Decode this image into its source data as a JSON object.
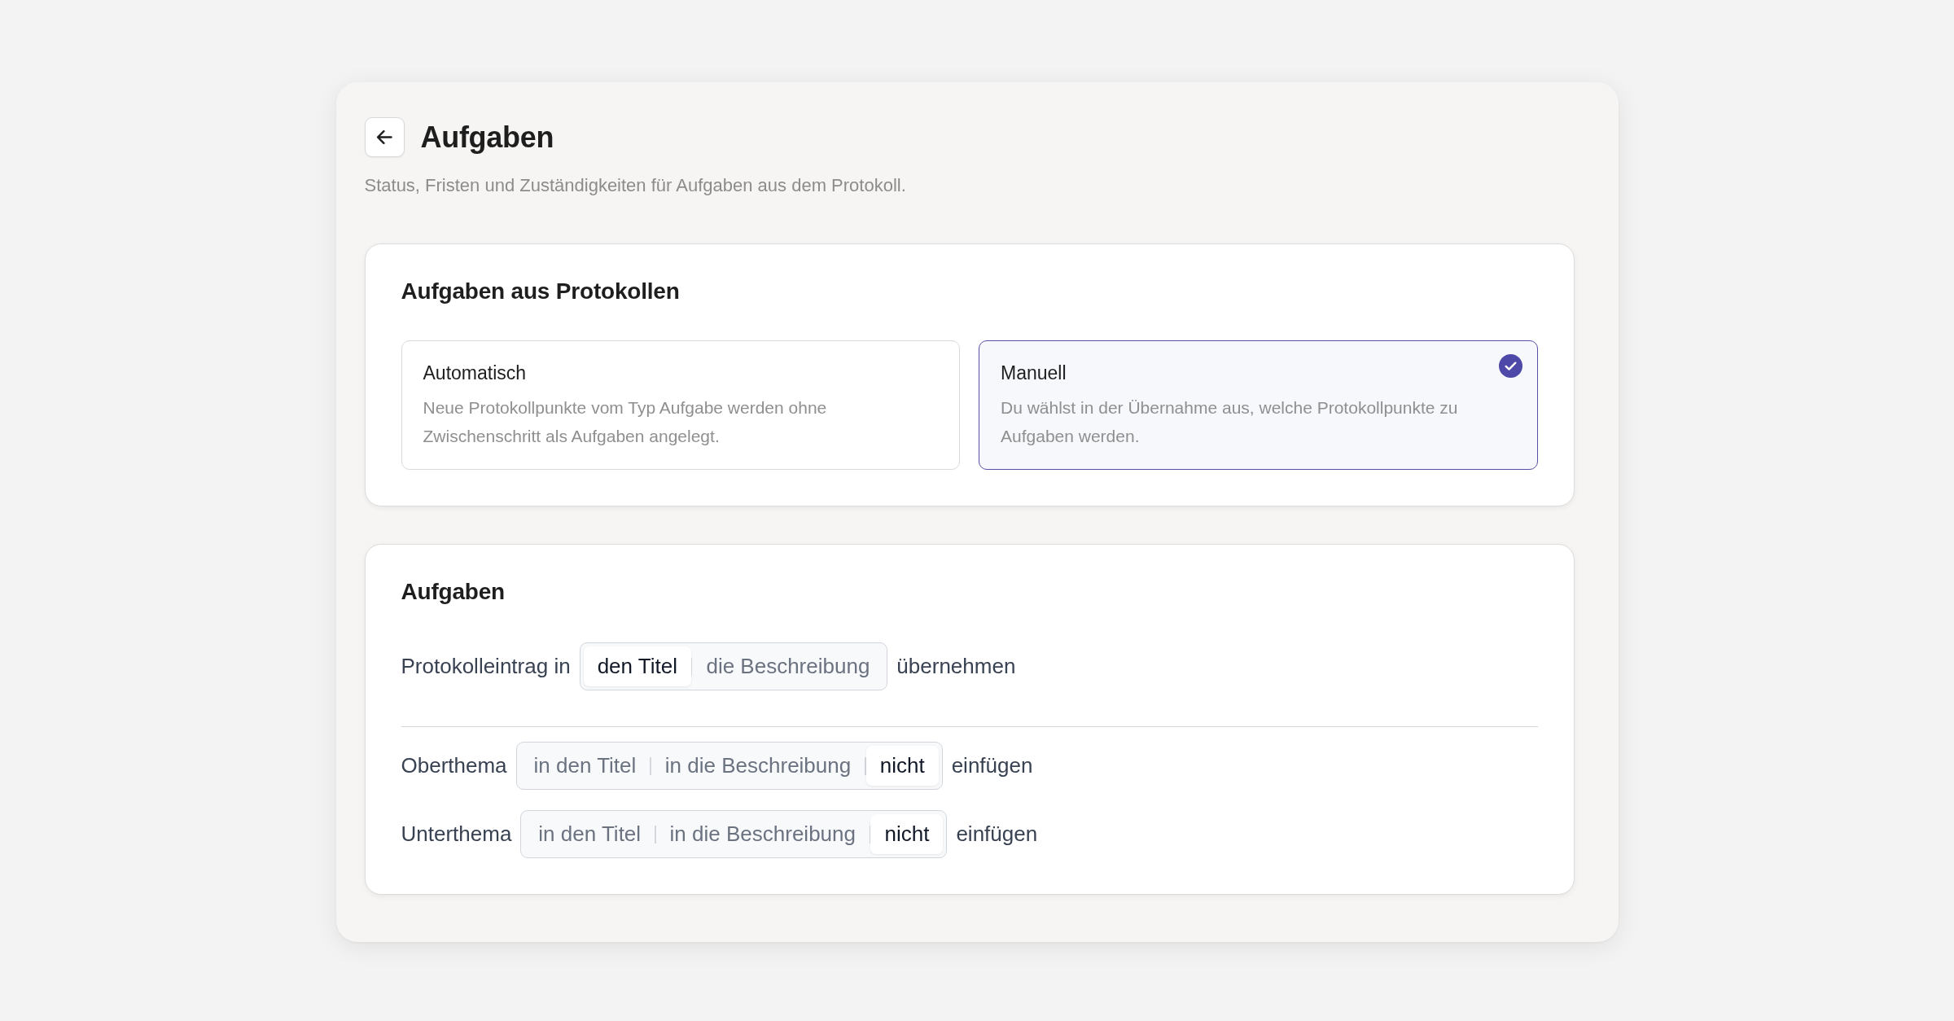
{
  "header": {
    "title": "Aufgaben",
    "subtitle": "Status, Fristen und Zuständigkeiten für Aufgaben aus dem Protokoll."
  },
  "sections": [
    {
      "kind": "options",
      "title": "Aufgaben aus Protokollen",
      "options": [
        {
          "title": "Automatisch",
          "description": "Neue Protokollpunkte vom Typ Aufgabe werden ohne Zwischenschritt als Aufgaben angelegt.",
          "selected": false
        },
        {
          "title": "Manuell",
          "description": "Du wählst in der Übernahme aus, welche Protokollpunkte zu Aufgaben werden.",
          "selected": true
        }
      ]
    },
    {
      "kind": "settings",
      "title": "Aufgaben",
      "groups": [
        {
          "rows": [
            {
              "label": "Protokolleintrag in",
              "segments": [
                {
                  "label": "den Titel",
                  "selected": true
                },
                {
                  "label": "die Beschreibung",
                  "selected": false
                }
              ],
              "suffix": "übernehmen"
            }
          ]
        },
        {
          "rows": [
            {
              "label": "Oberthema",
              "segments": [
                {
                  "label": "in den Titel",
                  "selected": false
                },
                {
                  "label": "in die Beschreibung",
                  "selected": false
                },
                {
                  "label": "nicht",
                  "selected": true
                }
              ],
              "suffix": "einfügen"
            },
            {
              "label": "Unterthema",
              "segments": [
                {
                  "label": "in den Titel",
                  "selected": false
                },
                {
                  "label": "in die Beschreibung",
                  "selected": false
                },
                {
                  "label": "nicht",
                  "selected": true
                }
              ],
              "suffix": "einfügen"
            }
          ]
        }
      ]
    }
  ]
}
